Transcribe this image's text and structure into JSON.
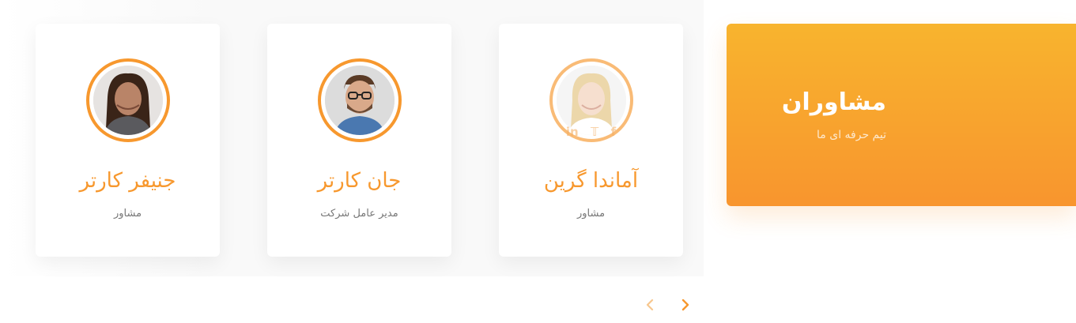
{
  "section": {
    "title": "مشاوران",
    "subtitle": "تیم حرفه ای ما"
  },
  "team": [
    {
      "name": "آماندا گرین",
      "role": "مشاور",
      "avatar_icon": "woman-blonde-photo",
      "hover_social": [
        "in",
        "twitter",
        "f"
      ]
    },
    {
      "name": "جان کارتر",
      "role": "مدیر عامل شرکت",
      "avatar_icon": "man-glasses-photo"
    },
    {
      "name": "جنیفر کارتر",
      "role": "مشاور",
      "avatar_icon": "woman-dark-hair-photo"
    }
  ],
  "carousel": {
    "prev_icon": "chevron-left-icon",
    "next_icon": "chevron-right-icon"
  },
  "colors": {
    "accent": "#f7982e",
    "hero_top": "#f8b42e",
    "hero_bottom": "#f8952e",
    "role_text": "#777777"
  }
}
